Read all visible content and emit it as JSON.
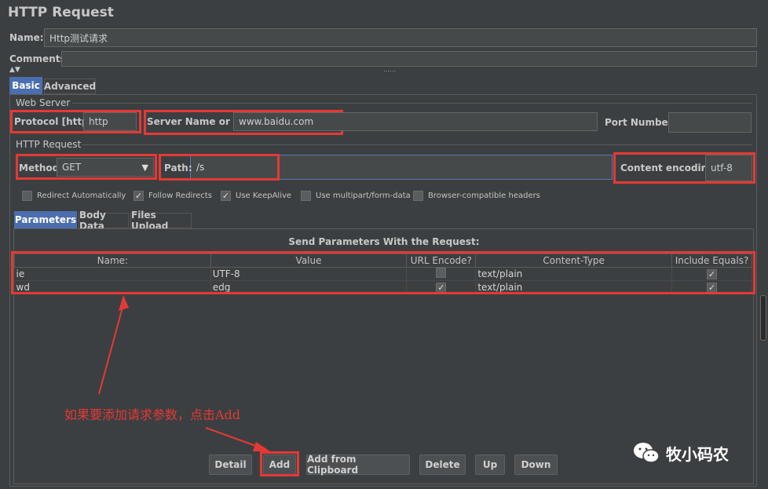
{
  "window_title": "HTTP Request",
  "name": {
    "label": "Name:",
    "value": "Http测试请求"
  },
  "comments": {
    "label": "Comments:",
    "value": ""
  },
  "tabs": [
    {
      "label": "Basic",
      "active": true
    },
    {
      "label": "Advanced",
      "active": false
    }
  ],
  "web_server": {
    "group_label": "Web Server",
    "protocol_label": "Protocol [http]:",
    "protocol_value": "http",
    "server_label": "Server Name or IP:",
    "server_value": "www.baidu.com",
    "port_label": "Port Number:",
    "port_value": ""
  },
  "http_request": {
    "group_label": "HTTP Request",
    "method_label": "Method:",
    "method_value": "GET",
    "path_label": "Path:",
    "path_value": "/s",
    "encoding_label": "Content encoding:",
    "encoding_value": "utf-8"
  },
  "options": [
    {
      "label": "Redirect Automatically",
      "checked": false
    },
    {
      "label": "Follow Redirects",
      "checked": true
    },
    {
      "label": "Use KeepAlive",
      "checked": true
    },
    {
      "label": "Use multipart/form-data",
      "checked": false
    },
    {
      "label": "Browser-compatible headers",
      "checked": false
    }
  ],
  "sub_tabs": [
    {
      "label": "Parameters",
      "active": true
    },
    {
      "label": "Body Data",
      "active": false
    },
    {
      "label": "Files Upload",
      "active": false
    }
  ],
  "params": {
    "title": "Send Parameters With the Request:",
    "columns": [
      "Name:",
      "Value",
      "URL Encode?",
      "Content-Type",
      "Include Equals?"
    ],
    "rows": [
      {
        "name": "ie",
        "value": "UTF-8",
        "url_encode": false,
        "content_type": "text/plain",
        "include_equals": true
      },
      {
        "name": "wd",
        "value": "edg",
        "url_encode": true,
        "content_type": "text/plain",
        "include_equals": true
      }
    ]
  },
  "buttons": {
    "detail": "Detail",
    "add": "Add",
    "add_clipboard": "Add from Clipboard",
    "delete": "Delete",
    "up": "Up",
    "down": "Down"
  },
  "annotation": "如果要添加请求参数，点击Add",
  "watermark": "牧小码农",
  "colors": {
    "highlight": "#e53935",
    "tab_active": "#4b6eaf",
    "background": "#3c3f41"
  }
}
